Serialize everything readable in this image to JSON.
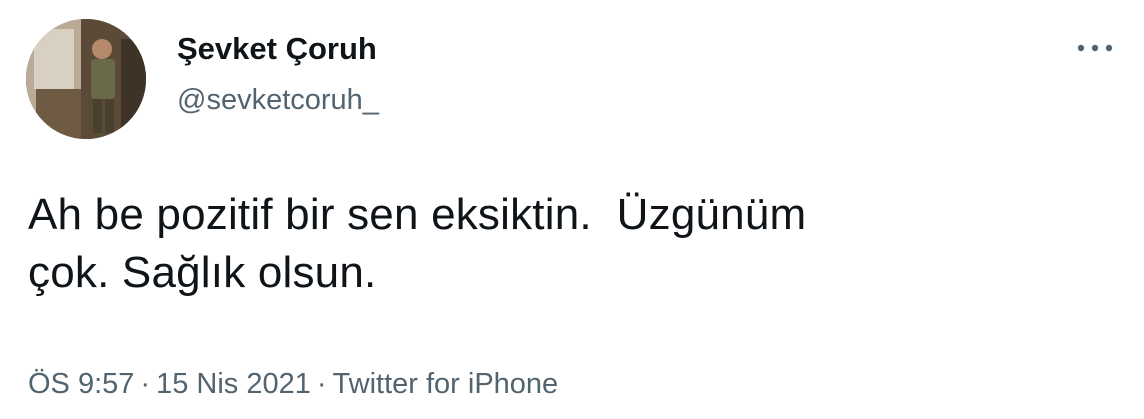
{
  "author": {
    "display_name": "Şevket Çoruh",
    "handle": "@sevketcoruh_"
  },
  "tweet": {
    "text": "Ah be pozitif bir sen eksiktin.  Üzgünüm\nçok. Sağlık olsun.",
    "time": "ÖS 9:57",
    "separator": "·",
    "date": "15 Nis 2021",
    "source": "Twitter for iPhone"
  },
  "icons": {
    "more": "more-horizontal-icon"
  },
  "colors": {
    "primary_text": "#0f1419",
    "secondary_text": "#536471",
    "background": "#ffffff"
  }
}
